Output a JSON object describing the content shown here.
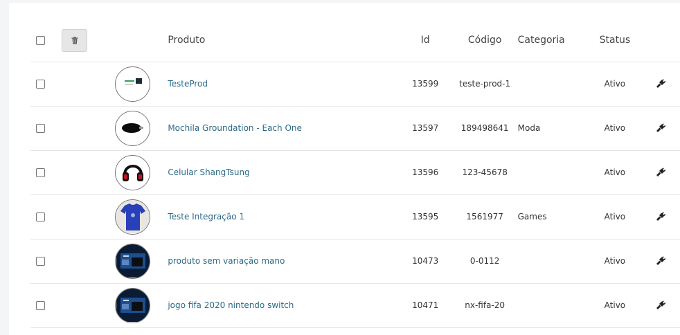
{
  "table": {
    "headers": {
      "produto": "Produto",
      "id": "Id",
      "codigo": "Código",
      "categoria": "Categoria",
      "status": "Status"
    },
    "rows": [
      {
        "name": "TesteProd",
        "id": "13599",
        "code": "teste-prod-1",
        "category": "",
        "status": "Ativo",
        "image": "screen-thumbnail"
      },
      {
        "name": "Mochila Groundation - Each One",
        "id": "13597",
        "code": "189498641",
        "category": "Moda",
        "status": "Ativo",
        "image": "black-oval-logo-thumbnail"
      },
      {
        "name": "Celular ShangTsung",
        "id": "13596",
        "code": "123-45678",
        "category": "",
        "status": "Ativo",
        "image": "headset-thumbnail"
      },
      {
        "name": "Teste Integração 1",
        "id": "13595",
        "code": "1561977",
        "category": "Games",
        "status": "Ativo",
        "image": "blue-tshirt-thumbnail"
      },
      {
        "name": "produto sem variação mano",
        "id": "10473",
        "code": "0-0112",
        "category": "",
        "status": "Ativo",
        "image": "console-box-thumbnail"
      },
      {
        "name": "jogo fifa 2020 nintendo switch",
        "id": "10471",
        "code": "nx-fifa-20",
        "category": "",
        "status": "Ativo",
        "image": "console-box-thumbnail"
      }
    ]
  },
  "icons": {
    "bulk_delete": "trash-icon",
    "row_action": "plug-icon"
  },
  "colors": {
    "link": "#2c6a86",
    "border": "#e3e5e8",
    "page_bg": "#f4f5f6"
  }
}
